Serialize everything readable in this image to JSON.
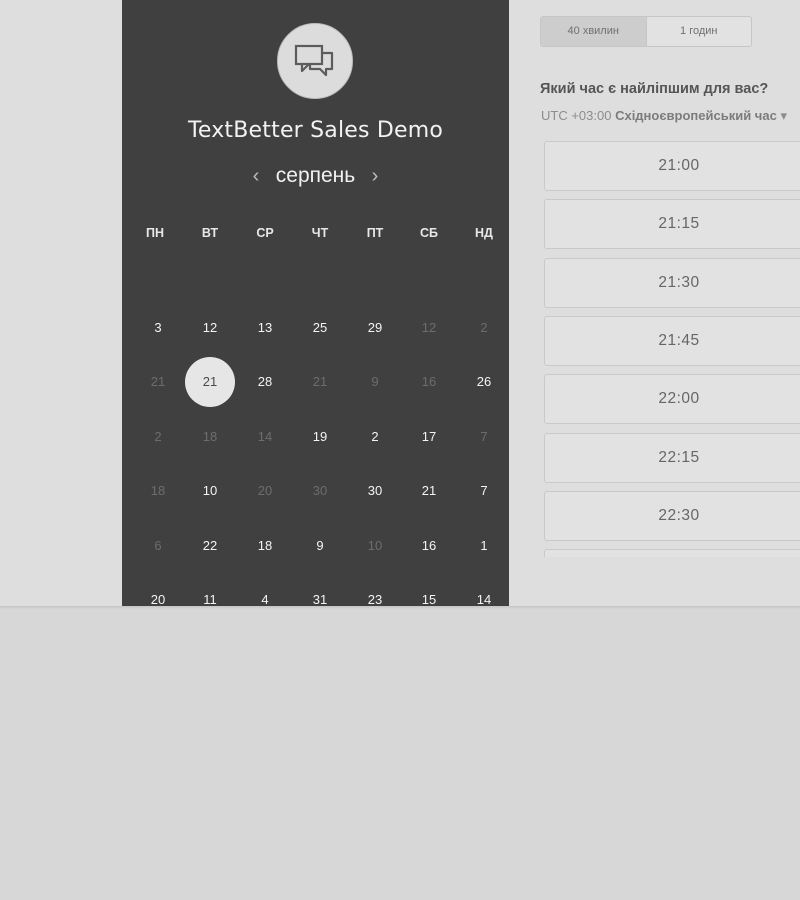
{
  "calendar": {
    "event_title": "TextBetter Sales Demo",
    "month": "серпень",
    "prev_arrow": "‹",
    "next_arrow": "›",
    "weekdays": [
      "ПН",
      "ВТ",
      "СР",
      "ЧТ",
      "ПТ",
      "СБ",
      "НД"
    ],
    "weeks": [
      [
        {
          "d": "3"
        },
        {
          "d": "12"
        },
        {
          "d": "13"
        },
        {
          "d": "25"
        },
        {
          "d": "29"
        },
        {
          "d": "12",
          "m": true
        },
        {
          "d": "2",
          "m": true
        }
      ],
      [
        {
          "d": "21",
          "m": true
        },
        {
          "d": "21",
          "sel": true
        },
        {
          "d": "28"
        },
        {
          "d": "21",
          "m": true
        },
        {
          "d": "9",
          "m": true
        },
        {
          "d": "16",
          "m": true
        },
        {
          "d": "26"
        }
      ],
      [
        {
          "d": "2",
          "m": true
        },
        {
          "d": "18",
          "m": true
        },
        {
          "d": "14",
          "m": true
        },
        {
          "d": "19"
        },
        {
          "d": "2"
        },
        {
          "d": "17"
        },
        {
          "d": "7",
          "m": true
        }
      ],
      [
        {
          "d": "18",
          "m": true
        },
        {
          "d": "10"
        },
        {
          "d": "20",
          "m": true
        },
        {
          "d": "30",
          "m": true
        },
        {
          "d": "30"
        },
        {
          "d": "21"
        },
        {
          "d": "7"
        }
      ],
      [
        {
          "d": "6",
          "m": true
        },
        {
          "d": "22"
        },
        {
          "d": "18"
        },
        {
          "d": "9"
        },
        {
          "d": "10",
          "m": true
        },
        {
          "d": "16"
        },
        {
          "d": "1"
        }
      ],
      [
        {
          "d": "20"
        },
        {
          "d": "11"
        },
        {
          "d": "4"
        },
        {
          "d": "31"
        },
        {
          "d": "23"
        },
        {
          "d": "15"
        },
        {
          "d": "14"
        }
      ]
    ],
    "icons": {
      "avatar": "chat-bubbles-icon",
      "prev": "chevron-left-icon",
      "next": "chevron-right-icon"
    }
  },
  "scheduler": {
    "durations": [
      {
        "label": "40 хвилин",
        "active": true
      },
      {
        "label": "1 годин",
        "active": false
      }
    ],
    "question": "Який час є найліпшим для вас?",
    "timezone_offset": "UTC +03:00",
    "timezone_name": "Східноєвропейський час",
    "timezone_caret": "▾",
    "slots": [
      "21:00",
      "21:15",
      "21:30",
      "21:45",
      "22:00",
      "22:15",
      "22:30",
      ""
    ]
  },
  "colors": {
    "panel": "#404040",
    "background": "#d7d7d7",
    "selected_day": "#e6e6e6"
  }
}
